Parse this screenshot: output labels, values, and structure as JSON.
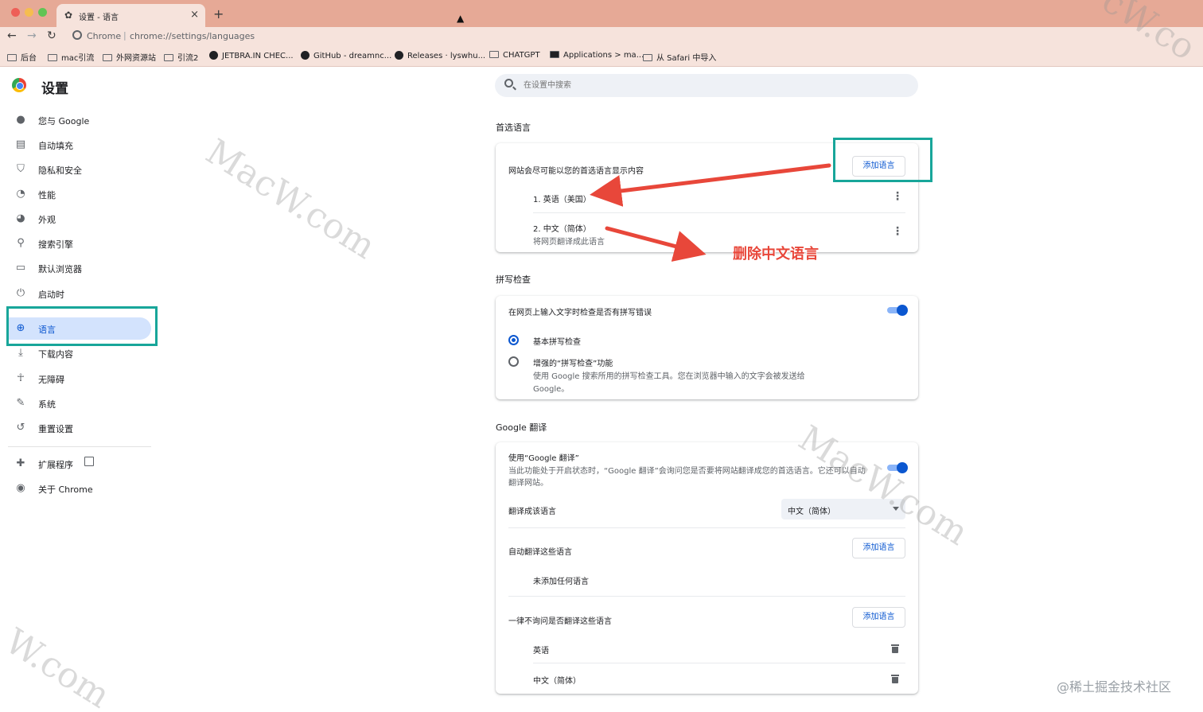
{
  "browser": {
    "tab_title": "设置 - 语言",
    "new_tab_symbol": "+",
    "close_symbol": "×",
    "site_name": "Chrome",
    "url": "chrome://settings/languages"
  },
  "bookmarks": [
    {
      "label": "后台",
      "icon": "folder-icon"
    },
    {
      "label": "mac引流",
      "icon": "folder-icon"
    },
    {
      "label": "外网资源站",
      "icon": "folder-icon"
    },
    {
      "label": "引流2",
      "icon": "folder-icon"
    },
    {
      "label": "JETBRA.IN CHEC...",
      "icon": "globe-icon"
    },
    {
      "label": "GitHub - dreamnc...",
      "icon": "github-icon"
    },
    {
      "label": "Releases · lyswhu...",
      "icon": "github-icon"
    },
    {
      "label": "CHATGPT",
      "icon": "folder-icon"
    },
    {
      "label": "Applications > ma...",
      "icon": "app-icon"
    },
    {
      "label": "从 Safari 中导入",
      "icon": "folder-icon"
    }
  ],
  "sidebar": {
    "title": "设置",
    "items": [
      {
        "label": "您与 Google",
        "icon": "person-icon"
      },
      {
        "label": "自动填充",
        "icon": "clipboard-icon"
      },
      {
        "label": "隐私和安全",
        "icon": "shield-icon"
      },
      {
        "label": "性能",
        "icon": "gauge-icon"
      },
      {
        "label": "外观",
        "icon": "palette-icon"
      },
      {
        "label": "搜索引擎",
        "icon": "search-icon"
      },
      {
        "label": "默认浏览器",
        "icon": "browser-icon"
      },
      {
        "label": "启动时",
        "icon": "power-icon"
      },
      {
        "label": "语言",
        "icon": "globe-icon",
        "active": true
      },
      {
        "label": "下载内容",
        "icon": "download-icon"
      },
      {
        "label": "无障碍",
        "icon": "accessibility-icon"
      },
      {
        "label": "系统",
        "icon": "wrench-icon"
      },
      {
        "label": "重置设置",
        "icon": "history-icon"
      },
      {
        "label": "扩展程序",
        "icon": "puzzle-icon"
      },
      {
        "label": "关于 Chrome",
        "icon": "chrome-icon"
      }
    ]
  },
  "search": {
    "placeholder": "在设置中搜索"
  },
  "preferred": {
    "title": "首选语言",
    "desc": "网站会尽可能以您的首选语言显示内容",
    "add_button": "添加语言",
    "languages": [
      {
        "label": "1. 英语（美国）",
        "sub": ""
      },
      {
        "label": "2. 中文（简体）",
        "sub": "将网页翻译成此语言"
      }
    ]
  },
  "spellcheck": {
    "title": "拼写检查",
    "toggle_label": "在网页上输入文字时检查是否有拼写错误",
    "toggle_on": true,
    "options": [
      {
        "label": "基本拼写检查",
        "selected": true,
        "desc1": "",
        "desc2": ""
      },
      {
        "label": "增强的“拼写检查”功能",
        "selected": false,
        "desc1": "使用 Google 搜索所用的拼写检查工具。您在浏览器中输入的文字会被发送给",
        "desc2": "Google。"
      }
    ]
  },
  "translate": {
    "title": "Google 翻译",
    "use_label": "使用“Google 翻译”",
    "use_desc1": "当此功能处于开启状态时，“Google 翻译”会询问您是否要将网站翻译成您的首选语言。它还可以自动",
    "use_desc2": "翻译网站。",
    "toggle_on": true,
    "target_label": "翻译成该语言",
    "target_value": "中文（简体）",
    "auto_label": "自动翻译这些语言",
    "auto_button": "添加语言",
    "auto_empty": "未添加任何语言",
    "never_label": "一律不询问是否翻译这些语言",
    "never_button": "添加语言",
    "never_languages": [
      "英语",
      "中文（简体）"
    ]
  },
  "annotations": {
    "delete_note": "删除中文语言",
    "colors": {
      "highlight": "#18a69a",
      "arrow": "#e8473a"
    }
  },
  "watermarks": [
    "MacW.com",
    "MacW.com",
    "cW.co",
    "W.com"
  ],
  "credit": "@稀土掘金技术社区"
}
